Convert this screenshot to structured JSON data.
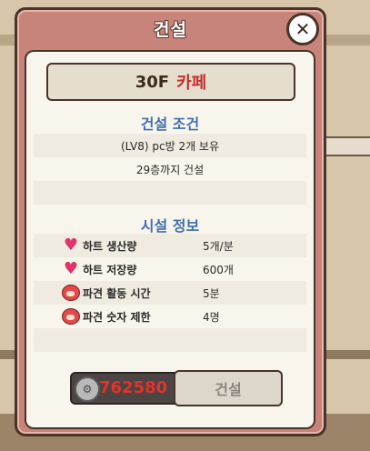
{
  "dialog": {
    "title": "건설",
    "close_icon": "close-icon"
  },
  "building": {
    "floor": "30F",
    "name": "카페"
  },
  "conditions": {
    "heading": "건설 조건",
    "rows": [
      "(LV8) pc방 2개 보유",
      "29층까지 건설"
    ]
  },
  "facility": {
    "heading": "시설 정보",
    "stats": [
      {
        "icon": "heart-icon",
        "label": "하트 생산량",
        "value": "5개/분"
      },
      {
        "icon": "heart-icon",
        "label": "하트 저장량",
        "value": "600개"
      },
      {
        "icon": "worker-icon",
        "label": "파견 활동 시간",
        "value": "5분"
      },
      {
        "icon": "worker-icon",
        "label": "파견 숫자 제한",
        "value": "4명"
      }
    ]
  },
  "cost": {
    "icon": "coin-icon",
    "value": "762580"
  },
  "build_button": {
    "label": "건설"
  },
  "colors": {
    "frame": "#c8847a",
    "heading": "#3f6fb0",
    "cost": "#e0332b",
    "shop_name": "#c0322b"
  }
}
